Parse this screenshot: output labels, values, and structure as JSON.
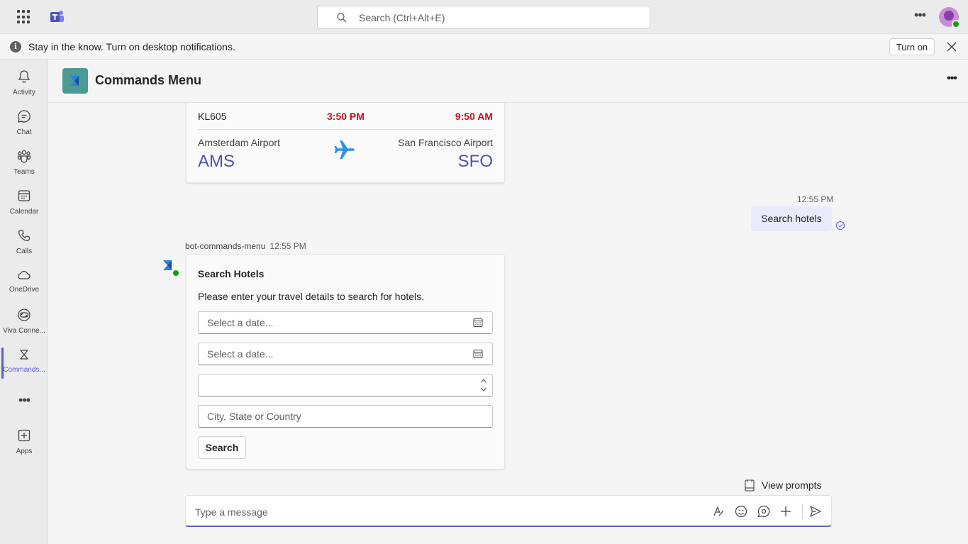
{
  "topbar": {
    "search_placeholder": "Search (Ctrl+Alt+E)"
  },
  "notification": {
    "message": "Stay in the know. Turn on desktop notifications.",
    "turn_on_label": "Turn on"
  },
  "rail": {
    "items": [
      {
        "label": "Activity",
        "icon": "bell-icon"
      },
      {
        "label": "Chat",
        "icon": "chat-icon"
      },
      {
        "label": "Teams",
        "icon": "teams-icon"
      },
      {
        "label": "Calendar",
        "icon": "calendar-icon"
      },
      {
        "label": "Calls",
        "icon": "phone-icon"
      },
      {
        "label": "OneDrive",
        "icon": "cloud-icon"
      },
      {
        "label": "Viva Conne...",
        "icon": "viva-connections-icon"
      },
      {
        "label": "Commands...",
        "icon": "commands-app-icon"
      },
      {
        "label": "Apps",
        "icon": "apps-add-icon"
      }
    ],
    "active_index": 7
  },
  "channel": {
    "title": "Commands Menu"
  },
  "flight_card": {
    "flight_number": "KL605",
    "departure_time": "3:50 PM",
    "arrival_time": "9:50 AM",
    "from_name": "Amsterdam Airport",
    "from_code": "AMS",
    "to_name": "San Francisco Airport",
    "to_code": "SFO"
  },
  "my_message": {
    "time": "12:55 PM",
    "text": "Search hotels"
  },
  "bot_message": {
    "sender": "bot-commands-menu",
    "time": "12:55 PM",
    "card": {
      "title": "Search Hotels",
      "description": "Please enter your travel details to search for hotels.",
      "checkin_placeholder": "Select a date...",
      "checkout_placeholder": "Select a date...",
      "guests_value": "",
      "location_placeholder": "City, State or Country",
      "search_label": "Search"
    }
  },
  "composer": {
    "view_prompts_label": "View prompts",
    "placeholder": "Type a message"
  },
  "colors": {
    "accent": "#5b5fc7",
    "time_red": "#c50f1f",
    "airport_code": "#4f52b2",
    "app_tile": "#4c9a94"
  }
}
